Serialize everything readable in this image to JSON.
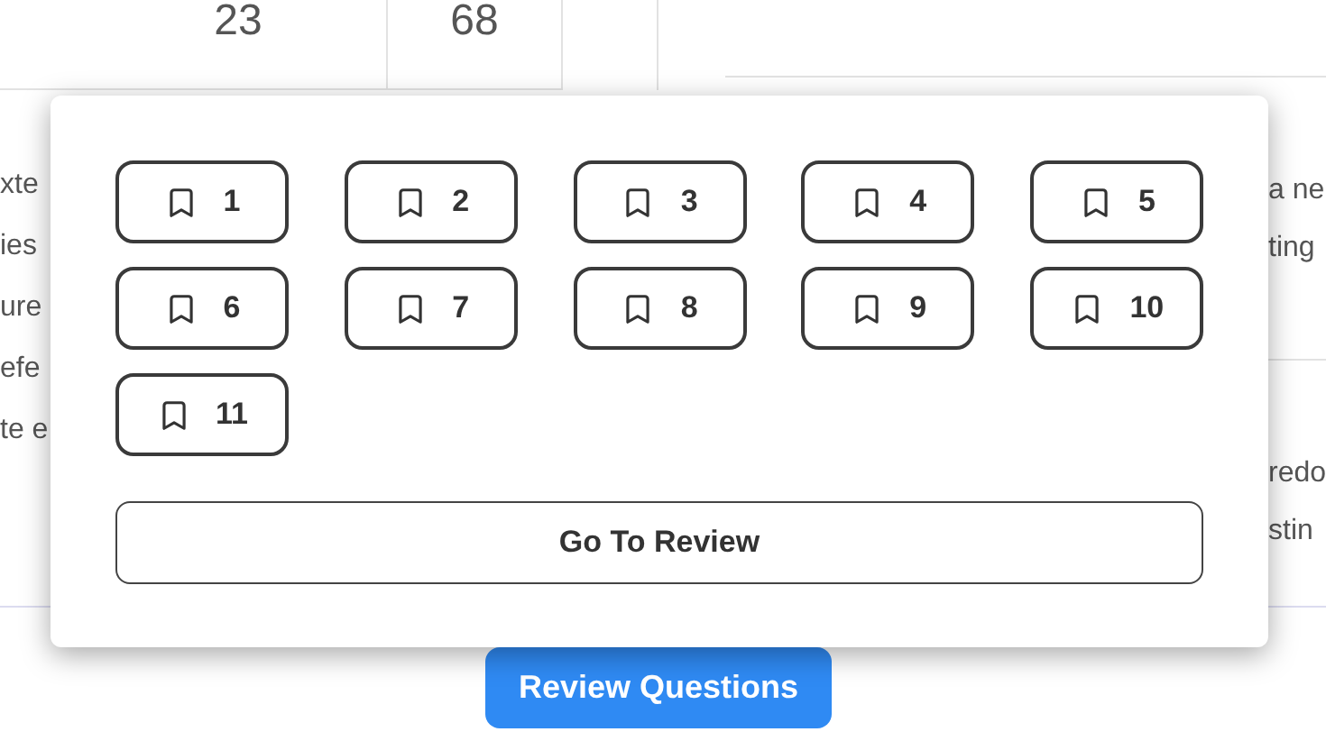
{
  "table": {
    "cells": [
      "23",
      "68"
    ]
  },
  "left_text": [
    "xte",
    "ies",
    "ure",
    "efe",
    "te e"
  ],
  "right_text": [
    [
      "a ne",
      "ting"
    ],
    [
      "redo",
      "stin"
    ]
  ],
  "popover": {
    "bookmarks": [
      {
        "label": "1"
      },
      {
        "label": "2"
      },
      {
        "label": "3"
      },
      {
        "label": "4"
      },
      {
        "label": "5"
      },
      {
        "label": "6"
      },
      {
        "label": "7"
      },
      {
        "label": "8"
      },
      {
        "label": "9"
      },
      {
        "label": "10"
      },
      {
        "label": "11"
      }
    ],
    "review_button": "Go To Review"
  },
  "review_questions_button": "Review Questions"
}
